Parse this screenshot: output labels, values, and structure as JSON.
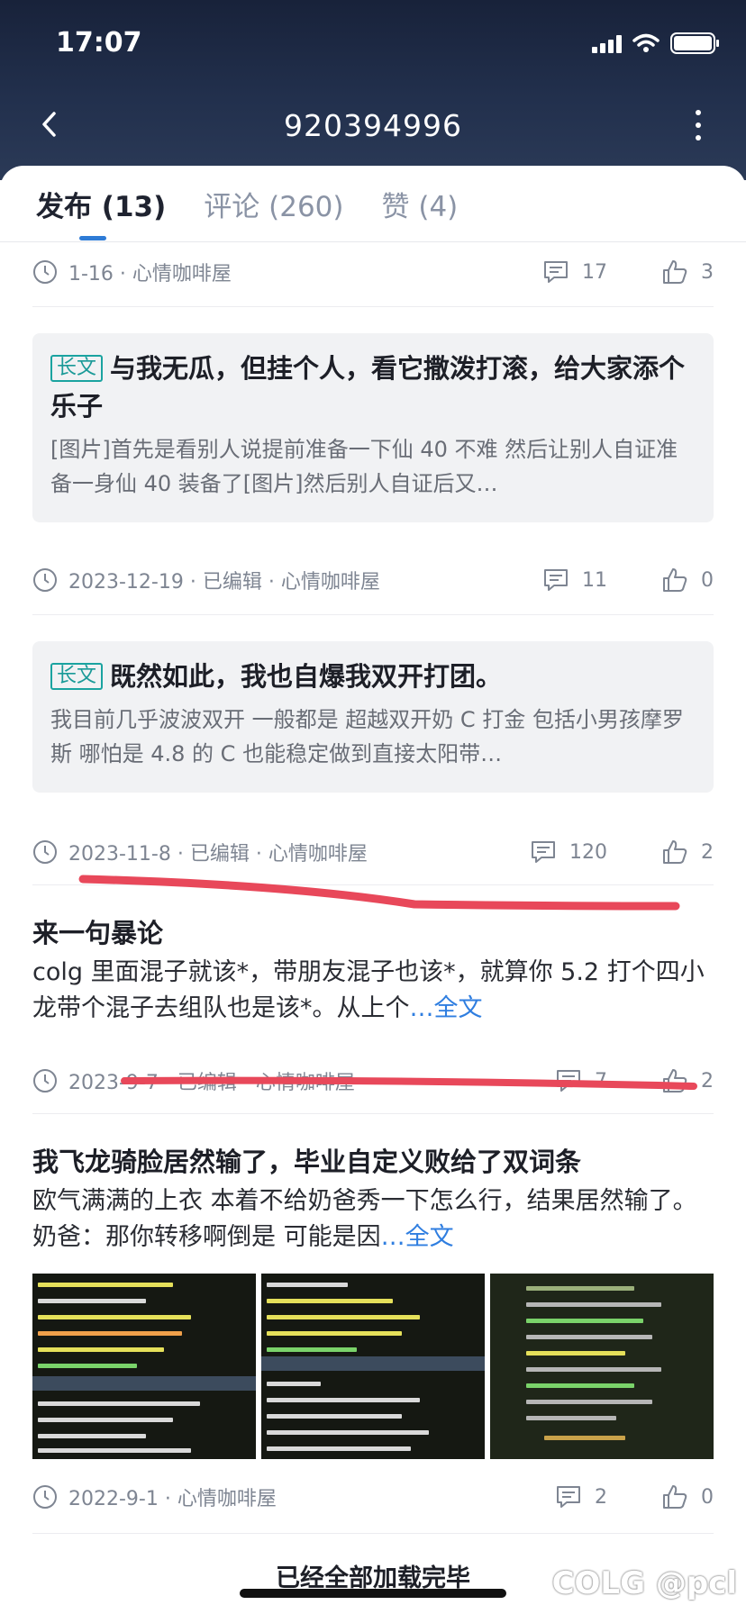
{
  "status_bar": {
    "time": "17:07"
  },
  "header": {
    "title": "920394996"
  },
  "tabs": [
    {
      "label": "发布 (13)",
      "active": true
    },
    {
      "label": "评论 (260)",
      "active": false
    },
    {
      "label": "赞 (4)",
      "active": false
    }
  ],
  "posts": [
    {
      "meta": "1-16 · 心情咖啡屋",
      "comments": "17",
      "likes": "3"
    },
    {
      "tag": "长文",
      "title": "与我无瓜，但挂个人，看它撒泼打滚，给大家添个乐子",
      "excerpt": "[图片]首先是看别人说提前准备一下仙 40 不难  然后让别人自证准备一身仙 40 装备了[图片]然后别人自证后又…",
      "meta": "2023-12-19 · 已编辑 · 心情咖啡屋",
      "comments": "11",
      "likes": "0"
    },
    {
      "tag": "长文",
      "title": "既然如此，我也自爆我双开打团。",
      "excerpt": "我目前几乎波波双开 一般都是  超越双开奶 C 打金   包括小男孩摩罗斯 哪怕是 4.8 的 C 也能稳定做到直接太阳带…",
      "meta": "2023-11-8 · 已编辑 · 心情咖啡屋",
      "comments": "120",
      "likes": "2"
    },
    {
      "title": "来一句暴论",
      "body": "colg 里面混子就该*，带朋友混子也该*，就算你 5.2 打个四小龙带个混子去组队也是该*。从上个",
      "more": "…全文",
      "meta": "2023-9-7 · 已编辑 · 心情咖啡屋",
      "comments": "7",
      "likes": "2"
    },
    {
      "title": "我飞龙骑脸居然输了，毕业自定义败给了双词条",
      "body": "欧气满满的上衣   本着不给奶爸秀一下怎么行，结果居然输了。奶爸：那你转移啊倒是     可能是因",
      "more": "…全文",
      "meta": "2022-9-1 · 心情咖啡屋",
      "comments": "2",
      "likes": "0"
    }
  ],
  "footer_text": "已经全部加载完毕",
  "watermark": "COLG @pcl",
  "colors": {
    "accent": "#2e7bd6",
    "tag": "#1aa3a0",
    "annotation": "#e8485a"
  }
}
